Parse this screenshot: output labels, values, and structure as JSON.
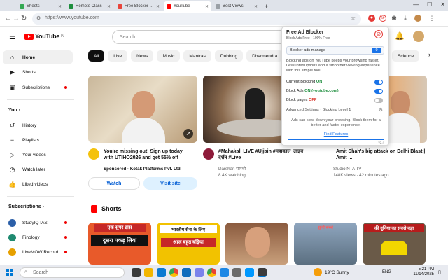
{
  "browser": {
    "tabs": [
      {
        "label": "Sheets",
        "active": false
      },
      {
        "label": "Remote Class",
        "active": false
      },
      {
        "label": "Free Blocker - Ad-Blocker & Web...",
        "active": false
      },
      {
        "label": "YouTube",
        "active": true
      },
      {
        "label": "Best Views",
        "active": false
      }
    ],
    "url": "https://www.youtube.com",
    "window_minimize": "—",
    "window_close": "✕"
  },
  "youtube": {
    "logo_text": "YouTube",
    "country_code": "IN",
    "search_placeholder": "Search"
  },
  "sidebar": {
    "main": [
      {
        "label": "Home",
        "icon": "home-icon"
      },
      {
        "label": "Shorts",
        "icon": "shorts-icon"
      },
      {
        "label": "Subscriptions",
        "icon": "subscriptions-icon"
      }
    ],
    "you_heading": "You",
    "you_items": [
      {
        "label": "History",
        "icon": "history-icon"
      },
      {
        "label": "Playlists",
        "icon": "playlists-icon"
      },
      {
        "label": "Your videos",
        "icon": "your-videos-icon"
      },
      {
        "label": "Watch later",
        "icon": "watch-later-icon"
      },
      {
        "label": "Liked videos",
        "icon": "liked-icon"
      }
    ],
    "subscriptions_heading": "Subscriptions",
    "subscriptions": [
      {
        "label": "StudyIQ IAS"
      },
      {
        "label": "Finology"
      },
      {
        "label": "LiveMOW Records..."
      }
    ]
  },
  "chips": [
    "All",
    "Live",
    "News",
    "Music",
    "Mantras",
    "Dubbing",
    "Dharmendra",
    "Science"
  ],
  "videos": [
    {
      "title": "You're missing out! Sign up today with UTIHO2026 and get 55% off",
      "channel": "Sponsored · Kotak Platforms Pvt. Ltd.",
      "meta": "",
      "primary_btn": "Watch",
      "secondary_btn": "Visit site"
    },
    {
      "title": "#Mahakal_LIVE #Ujjain #महाकाल_लाइव दर्शन #Live",
      "channel": "Darshan सारथी",
      "meta": "8.4K watching"
    },
    {
      "title": "Amit Shah's big attack on Delhi Blast | Amit ...",
      "channel": "Studio NTA TV",
      "meta": "148K views · 42 minutes ago"
    }
  ],
  "shorts_heading": "Shorts",
  "shorts_texts": [
    "एक सुपर डांस",
    "दूसरा पकड़ लिया",
    "भारतीय सेना के लिए",
    "आज बहुत बढ़िया",
    "सुनो बच्चे",
    "की दुनिया का सबसे बड़ा"
  ],
  "popup": {
    "title": "Free Ad Blocker",
    "subtitle": "Block Ads Free · 100% Free",
    "status_label": "Blocker ads manage",
    "status_value": "9",
    "description": "Blocking ads on YouTube keeps your browsing faster. Less interruptions and a smoother viewing experience with this simple tool.",
    "rows": [
      {
        "label": "Current Blocking",
        "value": "ON",
        "on": true
      },
      {
        "label": "Block Ads",
        "value": "ON (youtube.com)",
        "on": true
      },
      {
        "label": "Block pages",
        "value": "OFF",
        "on": false
      }
    ],
    "advanced": "Advanced Settings · Blocking Level 1",
    "footer_text": "Ads can slow down your browsing. Block them for a better and faster experience.",
    "footer_link": "Find Features",
    "version": "v2.4"
  },
  "taskbar": {
    "search_placeholder": "Search",
    "weather": "19°C Sunny",
    "time": "5:21 PM",
    "date": "11/14/2025",
    "lang": "ENG"
  },
  "colors": {
    "yt_red": "#ff0000",
    "accent_blue": "#1a73e8",
    "chip_active": "#0f0f0f"
  }
}
